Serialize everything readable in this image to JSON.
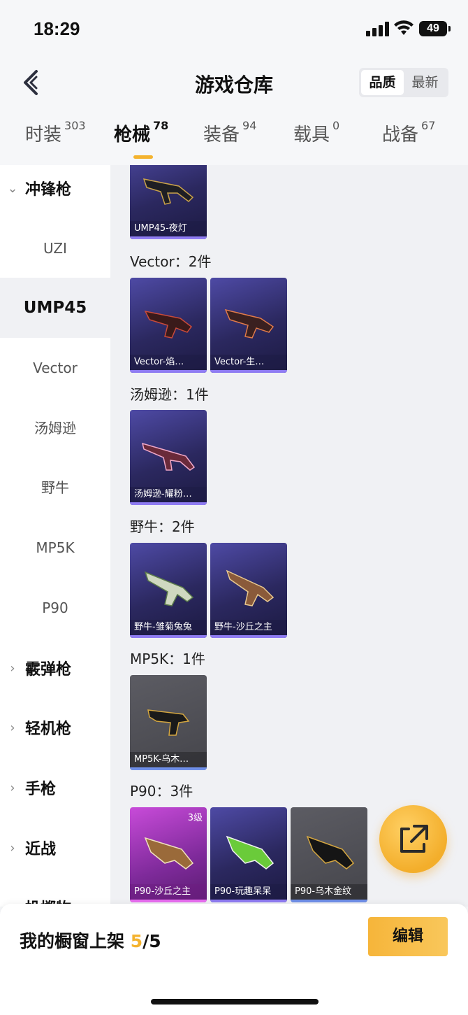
{
  "status": {
    "time": "18:29",
    "battery": "49"
  },
  "header": {
    "title": "游戏仓库",
    "sort": [
      "品质",
      "最新"
    ]
  },
  "tabs": [
    {
      "label": "时装",
      "count": "303"
    },
    {
      "label": "枪械",
      "count": "78"
    },
    {
      "label": "装备",
      "count": "94"
    },
    {
      "label": "载具",
      "count": "0"
    },
    {
      "label": "战备",
      "count": "67"
    }
  ],
  "sidebar": {
    "categories": [
      "冲锋枪",
      "霰弹枪",
      "轻机枪",
      "手枪",
      "近战",
      "投掷物"
    ],
    "subs": [
      "UZI",
      "UMP45",
      "Vector",
      "汤姆逊",
      "野牛",
      "MP5K",
      "P90"
    ]
  },
  "groups": [
    {
      "title": "",
      "items": [
        {
          "name": "UMP45-夜灯",
          "rarity": "purple"
        }
      ]
    },
    {
      "title": "Vector：2件",
      "items": [
        {
          "name": "Vector-焰…",
          "rarity": "purple"
        },
        {
          "name": "Vector-生…",
          "rarity": "purple"
        }
      ]
    },
    {
      "title": "汤姆逊：1件",
      "items": [
        {
          "name": "汤姆逊-耀粉…",
          "rarity": "purple"
        }
      ]
    },
    {
      "title": "野牛：2件",
      "items": [
        {
          "name": "野牛-雏菊兔兔",
          "rarity": "purple"
        },
        {
          "name": "野牛-沙丘之主",
          "rarity": "purple"
        }
      ]
    },
    {
      "title": "MP5K：1件",
      "items": [
        {
          "name": "MP5K-乌木…",
          "rarity": "gray"
        }
      ]
    },
    {
      "title": "P90：3件",
      "items": [
        {
          "name": "P90-沙丘之主",
          "rarity": "pink",
          "level": "3级"
        },
        {
          "name": "P90-玩趣呆呆",
          "rarity": "purple"
        },
        {
          "name": "P90-乌木金纹",
          "rarity": "gray"
        }
      ]
    }
  ],
  "bottom": {
    "label": "我的橱窗上架",
    "current": "5",
    "total": "/5",
    "edit": "编辑"
  },
  "colors": {
    "accent": "#f4b32f",
    "purple_card": "#2b285f",
    "gray_card": "#45454b",
    "pink_card": "#7e2a9a"
  }
}
